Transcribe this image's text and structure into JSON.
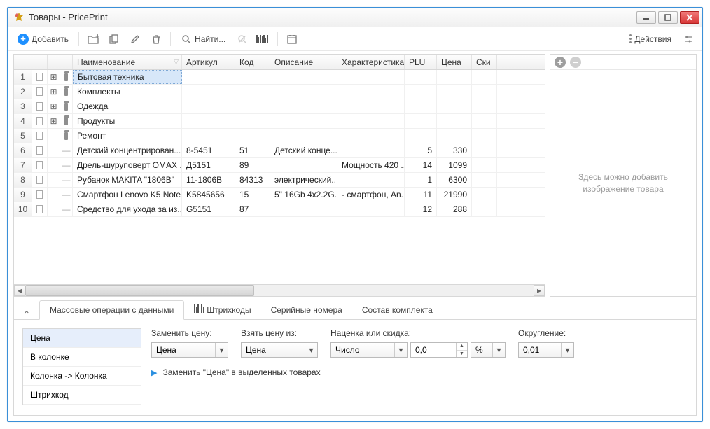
{
  "window": {
    "title": "Товары - PricePrint"
  },
  "toolbar": {
    "add": "Добавить",
    "search": "Найти...",
    "actions": "Действия"
  },
  "columns": {
    "name": "Наименование",
    "article": "Артикул",
    "code": "Код",
    "desc": "Описание",
    "char": "Характеристика",
    "plu": "PLU",
    "price": "Цена",
    "disc": "Ски"
  },
  "rows": [
    {
      "n": "1",
      "folder": true,
      "exp": true,
      "name": "Бытовая техника",
      "selected": true
    },
    {
      "n": "2",
      "folder": true,
      "exp": true,
      "name": "Комплекты"
    },
    {
      "n": "3",
      "folder": true,
      "exp": true,
      "name": "Одежда"
    },
    {
      "n": "4",
      "folder": true,
      "exp": true,
      "name": "Продукты"
    },
    {
      "n": "5",
      "folder": true,
      "exp": false,
      "name": "Ремонт"
    },
    {
      "n": "6",
      "folder": false,
      "name": "Детский концентрирован...",
      "art": "8-5451",
      "code": "51",
      "desc": "Детский конце...",
      "char": "",
      "plu": "5",
      "price": "330"
    },
    {
      "n": "7",
      "folder": false,
      "name": "Дрель-шуруповерт OMAX ...",
      "art": "Д5151",
      "code": "89",
      "desc": "",
      "char": "Мощность 420 ...",
      "plu": "14",
      "price": "1099"
    },
    {
      "n": "8",
      "folder": false,
      "name": "Рубанок MAKITA \"1806B\"",
      "art": "11-1806B",
      "code": "84313",
      "desc": "электрический...",
      "char": "",
      "plu": "1",
      "price": "6300"
    },
    {
      "n": "9",
      "folder": false,
      "name": "Смартфон Lenovo K5 Note",
      "art": "K5845656",
      "code": "15",
      "desc": "5\" 16Gb 4x2.2G...",
      "char": "- смартфон, An...",
      "plu": "11",
      "price": "21990"
    },
    {
      "n": "10",
      "folder": false,
      "name": "Средство для ухода за из...",
      "art": "G5151",
      "code": "87",
      "desc": "",
      "char": "",
      "plu": "12",
      "price": "288"
    }
  ],
  "sidepanel": {
    "placeholder": "Здесь можно добавить изображение товара"
  },
  "tabs": {
    "mass": "Массовые операции с данными",
    "barcode": "Штрихкоды",
    "serial": "Серийные номера",
    "bundle": "Состав комплекта"
  },
  "leftlist": [
    "Цена",
    "В колонке",
    "Колонка -> Колонка",
    "Штрихкод"
  ],
  "form": {
    "replace_lbl": "Заменить цену:",
    "replace_val": "Цена",
    "take_lbl": "Взять цену из:",
    "take_val": "Цена",
    "markup_lbl": "Наценка или скидка:",
    "markup_type": "Число",
    "markup_val": "0,0",
    "markup_unit": "%",
    "round_lbl": "Округление:",
    "round_val": "0,01",
    "action": "Заменить \"Цена\" в выделенных товарах"
  }
}
